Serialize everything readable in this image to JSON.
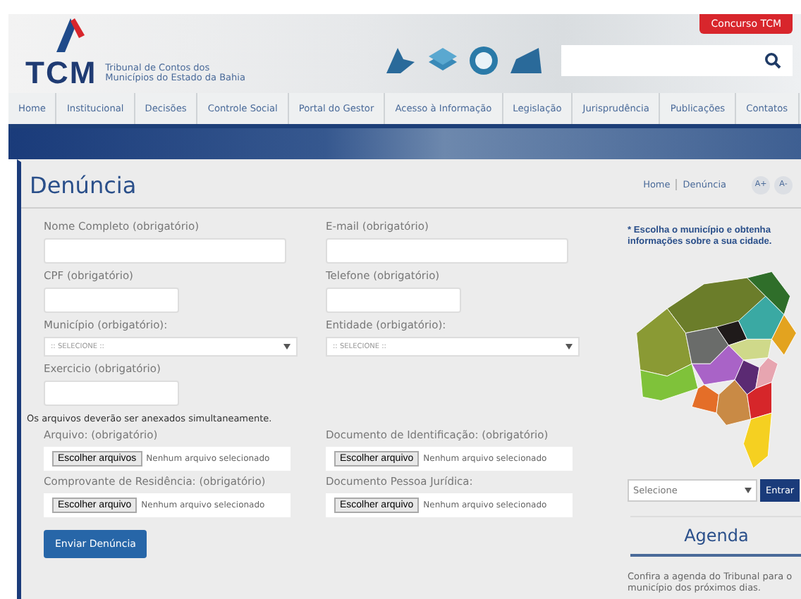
{
  "header": {
    "logo": "TCM",
    "logo_subtitle": "Tribunal de Contos dos Municípios do Estado da Bahia",
    "contest_button": "Concurso TCM"
  },
  "nav": [
    "Home",
    "Institucional",
    "Decisões",
    "Controle Social",
    "Portal do Gestor",
    "Acesso à Informação",
    "Legislação",
    "Jurisprudência",
    "Publicações",
    "Contatos"
  ],
  "page": {
    "title": "Denúncia",
    "breadcrumb": [
      "Home",
      "Denúncia"
    ],
    "font_buttons": [
      "A+",
      "A-"
    ]
  },
  "form": {
    "fields": [
      {
        "label": "Nome Completo (obrigatório)",
        "kind": "wide_text"
      },
      {
        "label": "E-mail (obrigatório)",
        "kind": "wide_text"
      },
      {
        "label": "CPF (obrigatório)",
        "kind": "short_text"
      },
      {
        "label": "Telefone (obrigatório)",
        "kind": "short_text"
      },
      {
        "label": "Município (orbigatório):",
        "kind": "select",
        "value": ":: SELECIONE ::"
      },
      {
        "label": "Entidade (orbigatório):",
        "kind": "select",
        "value": ":: SELECIONE ::"
      },
      {
        "label": "Exercicio (obrigatório)",
        "kind": "short_text"
      }
    ],
    "note": "Os arquivos deverão ser anexados simultaneamente.",
    "files": [
      {
        "label": "Arquivo: (obrigatório)",
        "button": "Escolher arquivos",
        "status": "Nenhum arquivo selecionado"
      },
      {
        "label": "Documento de Identificação: (obrigatório)",
        "button": "Escolher arquivo",
        "status": "Nenhum arquivo selecionado"
      },
      {
        "label": "Comprovante de Residência: (obrigatório)",
        "button": "Escolher arquivo",
        "status": "Nenhum arquivo selecionado"
      },
      {
        "label": "Documento Pessoa Jurídica:",
        "button": "Escolher arquivo",
        "status": "Nenhum arquivo selecionado"
      }
    ],
    "submit": "Enviar Denúncia"
  },
  "sidebar": {
    "hint": "* Escolha o município e obtenha informações sobre a sua cidade.",
    "select": "Selecione",
    "enter_button": "Entrar",
    "agenda_title": "Agenda",
    "agenda_text": "Confira a agenda do Tribunal para o município dos próximos dias."
  }
}
